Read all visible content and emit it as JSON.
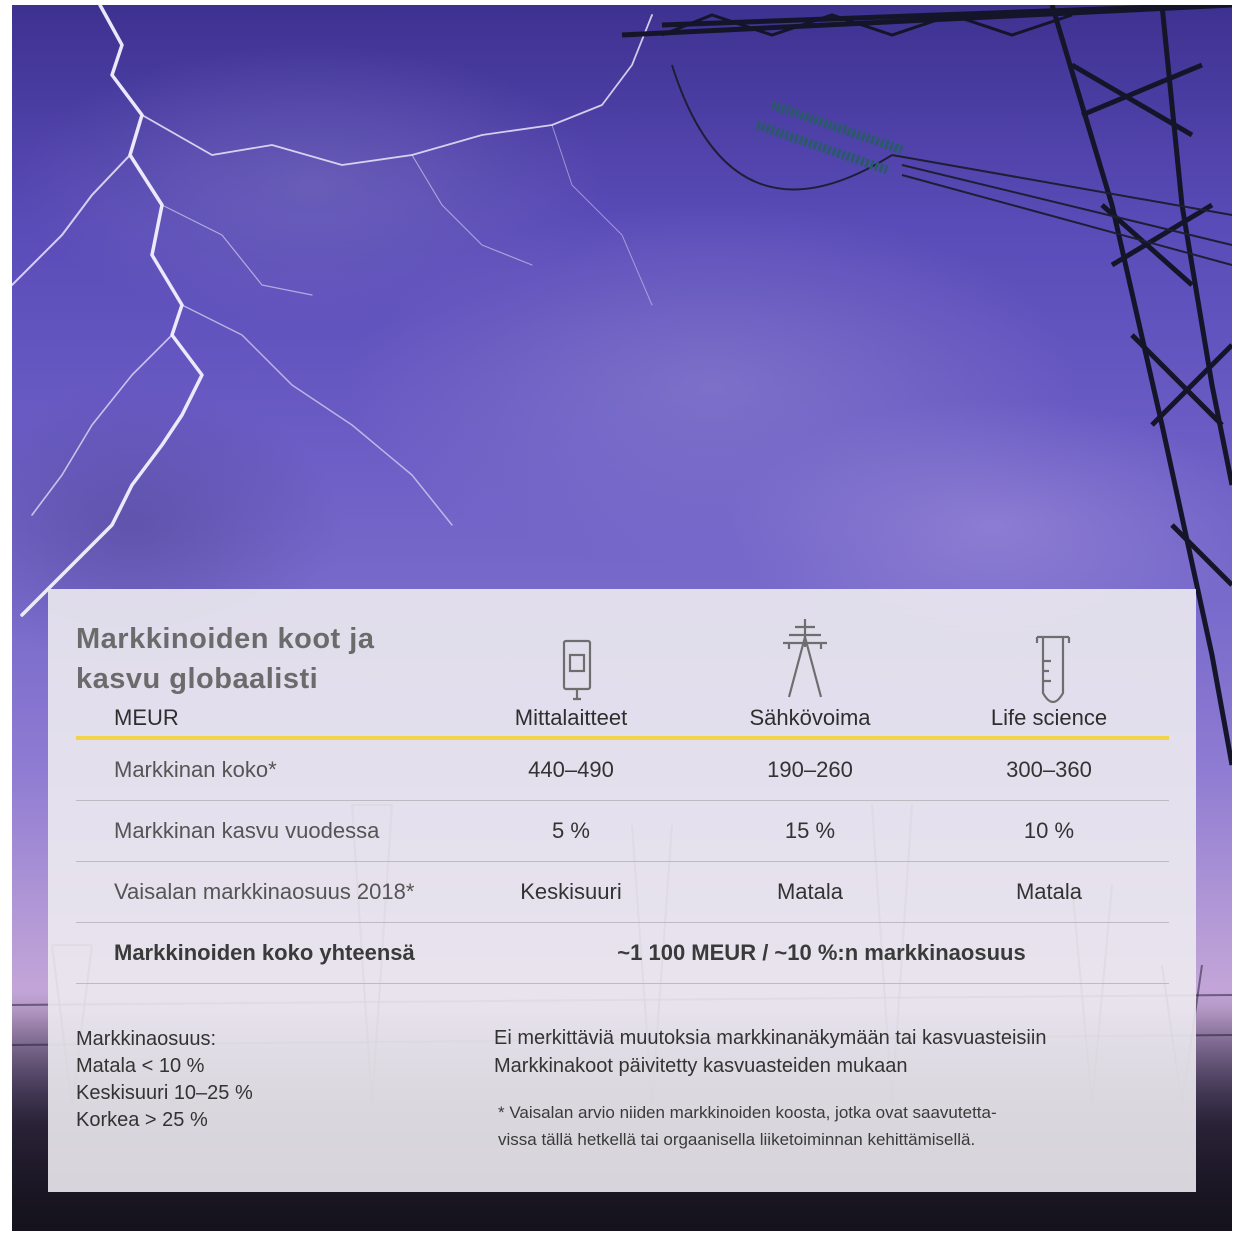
{
  "title_line1": "Markkinoiden koot ja",
  "title_line2": "kasvu globaalisti",
  "header": {
    "unit": "MEUR",
    "columns": [
      {
        "label": "Mittalaitteet",
        "icon": "meter-device-icon"
      },
      {
        "label": "Sähkövoima",
        "icon": "power-pylon-icon"
      },
      {
        "label": "Life science",
        "icon": "test-tube-icon"
      }
    ]
  },
  "rows": [
    {
      "label": "Markkinan koko*",
      "values": [
        "440–490",
        "190–260",
        "300–360"
      ]
    },
    {
      "label": "Markkinan kasvu vuodessa",
      "values": [
        "5 %",
        "15 %",
        "10 %"
      ]
    },
    {
      "label": "Vaisalan markkinaosuus 2018*",
      "values": [
        "Keskisuuri",
        "Matala",
        "Matala"
      ]
    }
  ],
  "total": {
    "label": "Markkinoiden koko yhteensä",
    "value": "~1 100 MEUR / ~10 %:n markkinaosuus"
  },
  "legend": {
    "heading": "Markkinaosuus:",
    "items": [
      "Matala < 10 %",
      "Keskisuuri 10–25 %",
      "Korkea > 25 %"
    ]
  },
  "notes": [
    "Ei merkittäviä muutoksia markkinanäkymään tai kasvuasteisiin",
    "Markkinakoot päivitetty kasvuasteiden mukaan"
  ],
  "footnote_line1": "* Vaisalan arvio niiden markkinoiden koosta, jotka ovat saavutetta-",
  "footnote_line2": "vissa tällä hetkellä tai orgaanisella liiketoiminnan kehittämisellä.",
  "colors": {
    "accent_line": "#f2d44a",
    "title": "#6b6b6b",
    "sky": "#5a4cb8"
  }
}
